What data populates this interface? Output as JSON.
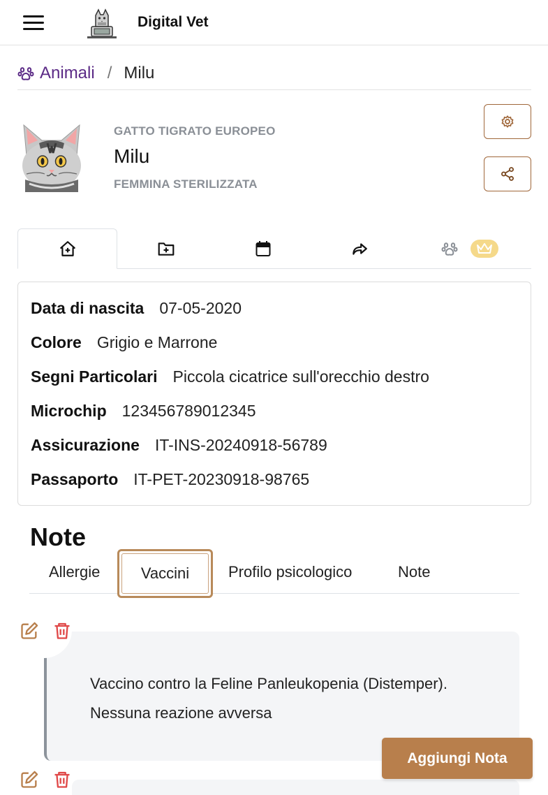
{
  "header": {
    "app_title": "Digital Vet"
  },
  "breadcrumb": {
    "parent": "Animali",
    "current": "Milu"
  },
  "profile": {
    "breed": "GATTO TIGRATO EUROPEO",
    "name": "Milu",
    "sex": "FEMMINA STERILIZZATA"
  },
  "tabs": [
    {
      "icon": "home-add-icon",
      "active": true
    },
    {
      "icon": "folder-add-icon",
      "active": false
    },
    {
      "icon": "calendar-icon",
      "active": false
    },
    {
      "icon": "share-arrow-icon",
      "active": false
    },
    {
      "icon": "paw-icon",
      "active": false,
      "badge_icon": "crown-icon"
    }
  ],
  "details": [
    {
      "label": "Data di nascita",
      "value": "07-05-2020"
    },
    {
      "label": "Colore",
      "value": "Grigio e Marrone"
    },
    {
      "label": "Segni Particolari",
      "value": "Piccola cicatrice sull'orecchio destro"
    },
    {
      "label": "Microchip",
      "value": "123456789012345"
    },
    {
      "label": "Assicurazione",
      "value": "IT-INS-20240918-56789"
    },
    {
      "label": "Passaporto",
      "value": "IT-PET-20230918-98765"
    }
  ],
  "notes": {
    "title": "Note",
    "tabs": [
      "Allergie",
      "Vaccini",
      "Profilo psicologico",
      "Note"
    ],
    "active_tab": "Vaccini",
    "items": [
      {
        "text": "Vaccino contro la Feline Panleukopenia (Distemper). Nessuna reazione avversa"
      }
    ],
    "add_button": "Aggiungi Nota"
  },
  "colors": {
    "accent": "#b87f4c",
    "breadcrumb_link": "#5b2a86",
    "delete": "#e04848",
    "crown_badge": "#f5d98a"
  }
}
